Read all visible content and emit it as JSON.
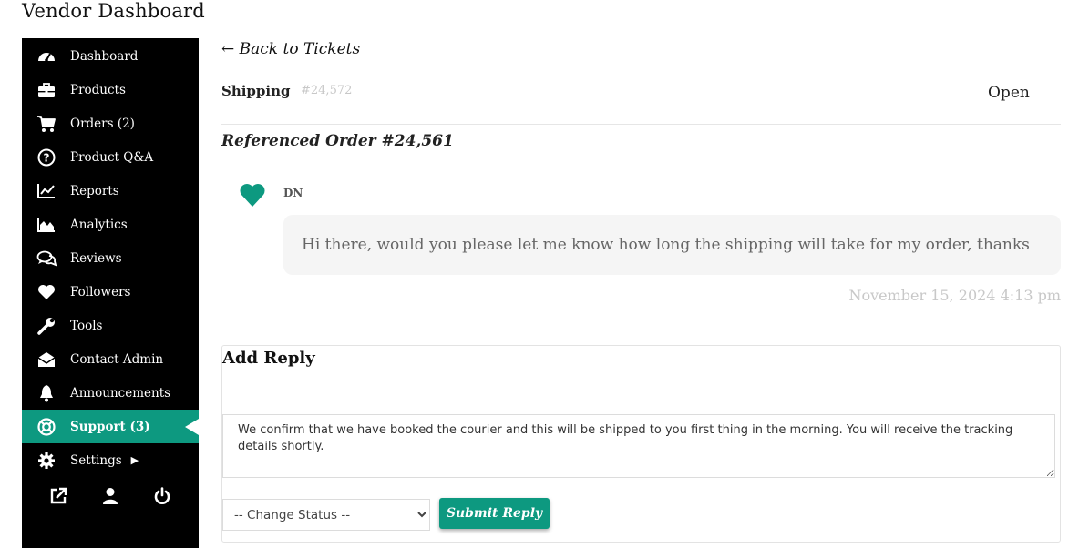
{
  "page_title": "Vendor Dashboard",
  "colors": {
    "accent": "#0d9980",
    "sidebar_bg": "#000000"
  },
  "sidebar": {
    "items": [
      {
        "label": "Dashboard",
        "icon": "gauge-icon"
      },
      {
        "label": "Products",
        "icon": "briefcase-icon"
      },
      {
        "label": "Orders (2)",
        "icon": "cart-icon"
      },
      {
        "label": "Product Q&A",
        "icon": "question-circle-icon"
      },
      {
        "label": "Reports",
        "icon": "line-chart-icon"
      },
      {
        "label": "Analytics",
        "icon": "area-chart-icon"
      },
      {
        "label": "Reviews",
        "icon": "comments-icon"
      },
      {
        "label": "Followers",
        "icon": "heart-icon"
      },
      {
        "label": "Tools",
        "icon": "wrench-icon"
      },
      {
        "label": "Contact Admin",
        "icon": "envelope-open-icon"
      },
      {
        "label": "Announcements",
        "icon": "bell-icon"
      },
      {
        "label": "Support (3)",
        "icon": "lifebuoy-icon",
        "active": true
      },
      {
        "label": "Settings",
        "icon": "gear-icon",
        "has_submenu": true
      }
    ],
    "footer_icons": [
      "external-link-icon",
      "user-icon",
      "power-icon"
    ]
  },
  "ticket": {
    "back_label": "← Back to Tickets",
    "topic": "Shipping",
    "number": "#24,572",
    "status": "Open",
    "referenced_order": "Referenced Order #24,561"
  },
  "message": {
    "author": "DN",
    "text": "Hi there, would you please let me know how long the shipping will take for my order, thanks",
    "time": "November 15, 2024 4:13 pm"
  },
  "reply": {
    "title": "Add Reply",
    "text": "We confirm that we have booked the courier and this will be shipped to you first thing in the morning. You will receive the tracking details shortly.",
    "status_select": "-- Change Status --",
    "submit_label": "Submit Reply"
  }
}
